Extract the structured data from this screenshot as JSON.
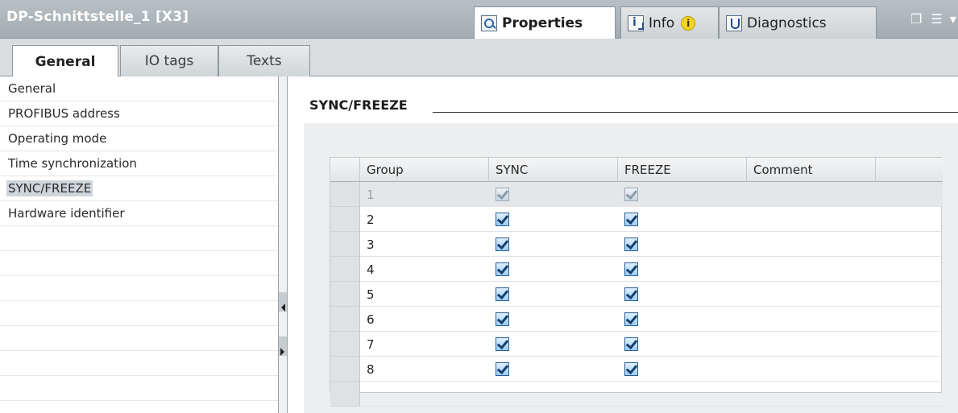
{
  "window": {
    "title": "DP-Schnittstelle_1 [X3]",
    "tabs": [
      {
        "label": "Properties",
        "icon": "properties-icon",
        "active": true
      },
      {
        "label": "Info",
        "icon": "info-icon",
        "active": false
      },
      {
        "label": "Diagnostics",
        "icon": "diagnostics-icon",
        "active": false
      }
    ],
    "window_controls": [
      "restore-icon",
      "menu-icon"
    ]
  },
  "subtabs": [
    {
      "label": "General",
      "active": true
    },
    {
      "label": "IO tags",
      "active": false
    },
    {
      "label": "Texts",
      "active": false
    }
  ],
  "nav": {
    "items": [
      {
        "label": "General",
        "selected": false
      },
      {
        "label": "PROFIBUS address",
        "selected": false
      },
      {
        "label": "Operating mode",
        "selected": false
      },
      {
        "label": "Time synchronization",
        "selected": false
      },
      {
        "label": "SYNC/FREEZE",
        "selected": true
      },
      {
        "label": "Hardware identifier",
        "selected": false
      }
    ]
  },
  "section": {
    "title": "SYNC/FREEZE"
  },
  "table": {
    "columns": [
      "Group",
      "SYNC",
      "FREEZE",
      "Comment"
    ],
    "rows": [
      {
        "group": "1",
        "sync": true,
        "freeze": true,
        "comment": "",
        "disabled": true
      },
      {
        "group": "2",
        "sync": true,
        "freeze": true,
        "comment": ""
      },
      {
        "group": "3",
        "sync": true,
        "freeze": true,
        "comment": ""
      },
      {
        "group": "4",
        "sync": true,
        "freeze": true,
        "comment": ""
      },
      {
        "group": "5",
        "sync": true,
        "freeze": true,
        "comment": ""
      },
      {
        "group": "6",
        "sync": true,
        "freeze": true,
        "comment": ""
      },
      {
        "group": "7",
        "sync": true,
        "freeze": true,
        "comment": ""
      },
      {
        "group": "8",
        "sync": true,
        "freeze": true,
        "comment": ""
      }
    ]
  },
  "colors": {
    "titlebar": "#a9b0b6",
    "accent": "#2a5c94",
    "warning": "#f5d322"
  }
}
